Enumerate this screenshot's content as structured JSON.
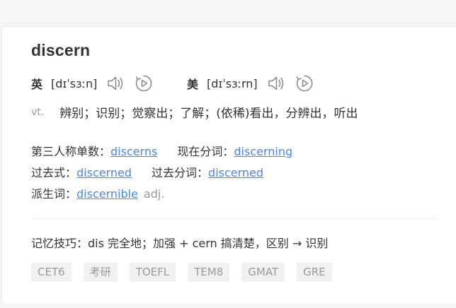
{
  "word": "discern",
  "pronunciations": [
    {
      "label": "英",
      "ipa": "[dɪˈsɜːn]"
    },
    {
      "label": "美",
      "ipa": "[dɪˈsɜːrn]"
    }
  ],
  "definition": {
    "pos": "vt.",
    "meaning": "辨别；识别；觉察出；了解；(依稀)看出，分辨出，听出"
  },
  "forms": {
    "third_person_label": "第三人称单数：",
    "third_person_value": "discerns",
    "present_participle_label": "现在分词：",
    "present_participle_value": "discerning",
    "past_tense_label": "过去式：",
    "past_tense_value": "discerned",
    "past_participle_label": "过去分词：",
    "past_participle_value": "discerned",
    "derivative_label": "派生词：",
    "derivative_value": "discernible",
    "derivative_pos": "adj."
  },
  "memory": "记忆技巧：dis 完全地；加强 + cern 搞清楚，区别 → 识别",
  "tags": [
    "CET6",
    "考研",
    "TOEFL",
    "TEM8",
    "GMAT",
    "GRE"
  ],
  "icons": [
    "speaker-icon",
    "play-circle-icon"
  ],
  "colors": {
    "link": "#4a86e8",
    "muted": "#999999",
    "tag_bg": "#f1f1f1"
  }
}
